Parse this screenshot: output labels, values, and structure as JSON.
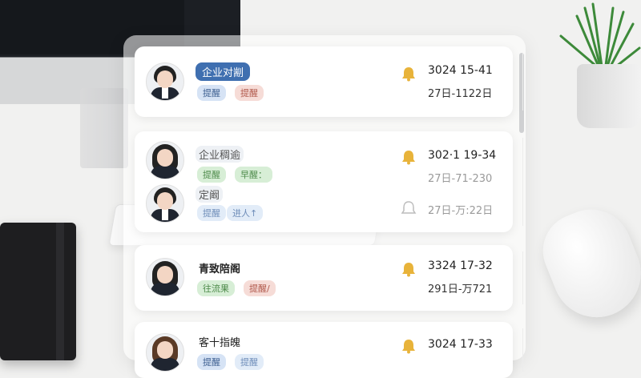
{
  "accent_blue": "#3f6fb0",
  "bell_color": "#e8b33a",
  "cards": [
    {
      "people": [
        {
          "name": "企业对剬",
          "tags": [
            "提醒",
            "提醒"
          ]
        }
      ],
      "reminder": {
        "time": "3024 15-41",
        "date": "27日-1122日"
      }
    },
    {
      "people": [
        {
          "name": "企业稠逾",
          "tags": [
            "提醒",
            "早醒："
          ]
        },
        {
          "name": "定阚",
          "tags": [
            "提醒",
            "进人↑"
          ]
        }
      ],
      "reminder": {
        "time": "302·1 19-34",
        "date": "27日-71-230",
        "date2": "27日-万:22日"
      }
    },
    {
      "people": [
        {
          "name": "青致陪阁",
          "tags": [
            "往流果",
            "提醒/"
          ]
        }
      ],
      "reminder": {
        "time": "3324 17-32",
        "date": "291日-万721"
      }
    },
    {
      "people": [
        {
          "name": "客十指魄",
          "tags": [
            "提醒",
            "提醒"
          ]
        }
      ],
      "reminder": {
        "time": "3024 17-33"
      }
    }
  ]
}
